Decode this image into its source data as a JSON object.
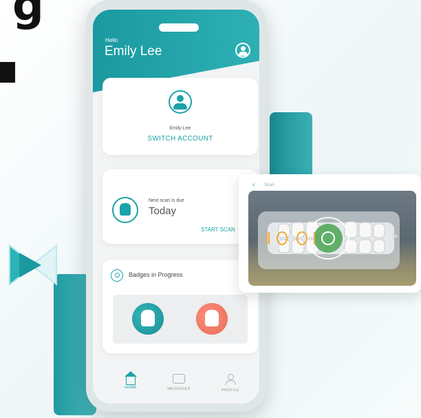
{
  "header": {
    "greeting": "Hello",
    "user_name": "Emily Lee",
    "profile_icon": "user-circle-icon"
  },
  "account_card": {
    "name": "Emily Lee",
    "switch_label": "SWITCH ACCOUNT",
    "icon": "user-avatar-icon"
  },
  "scan_card": {
    "next_label": "Next scan is due",
    "due_value": "Today",
    "action_label": "START SCAN",
    "icon": "tooth-badge-icon"
  },
  "badges_card": {
    "title": "Badges in Progress",
    "icon": "ribbon-icon",
    "badges": [
      {
        "color": "#1aa3a8",
        "icon": "tooth-icon"
      },
      {
        "color": "#ef7b66",
        "icon": "tooth-icon"
      }
    ]
  },
  "bottom_nav": {
    "items": [
      {
        "label": "HOME",
        "icon": "home-icon",
        "active": true
      },
      {
        "label": "MESSAGES",
        "icon": "message-icon",
        "active": false
      },
      {
        "label": "PROFILE",
        "icon": "people-icon",
        "active": false
      }
    ]
  },
  "scan_panel": {
    "back_icon": "chevron-left-icon",
    "title": "Scan"
  },
  "colors": {
    "accent": "#1aa3a8",
    "coral": "#ef7b66",
    "headline": "#111111"
  }
}
